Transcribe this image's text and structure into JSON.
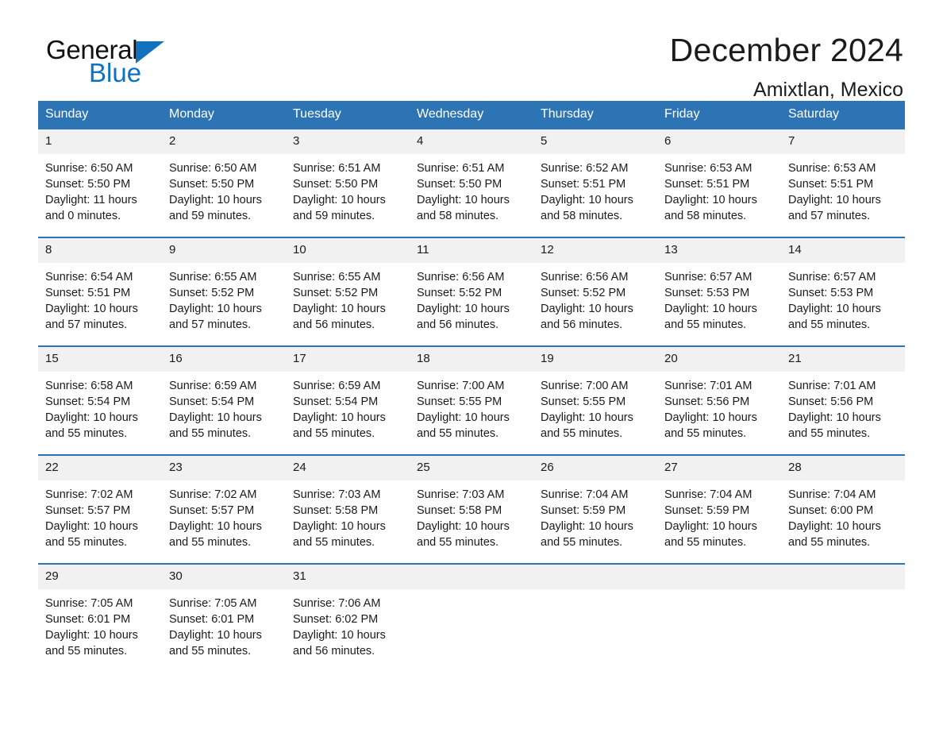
{
  "brand": {
    "name_part1": "General",
    "name_part2": "Blue",
    "mark_icon": "triangle-logo-icon",
    "accent_color": "#0d72c4"
  },
  "header": {
    "title": "December 2024",
    "subtitle": "Amixtlan, Mexico"
  },
  "calendar": {
    "header_color": "#2d74b5",
    "daynum_band_color": "#f1f1f1",
    "weekdays": [
      "Sunday",
      "Monday",
      "Tuesday",
      "Wednesday",
      "Thursday",
      "Friday",
      "Saturday"
    ],
    "weeks": [
      [
        {
          "day": "1",
          "sunrise": "Sunrise: 6:50 AM",
          "sunset": "Sunset: 5:50 PM",
          "daylight": "Daylight: 11 hours and 0 minutes."
        },
        {
          "day": "2",
          "sunrise": "Sunrise: 6:50 AM",
          "sunset": "Sunset: 5:50 PM",
          "daylight": "Daylight: 10 hours and 59 minutes."
        },
        {
          "day": "3",
          "sunrise": "Sunrise: 6:51 AM",
          "sunset": "Sunset: 5:50 PM",
          "daylight": "Daylight: 10 hours and 59 minutes."
        },
        {
          "day": "4",
          "sunrise": "Sunrise: 6:51 AM",
          "sunset": "Sunset: 5:50 PM",
          "daylight": "Daylight: 10 hours and 58 minutes."
        },
        {
          "day": "5",
          "sunrise": "Sunrise: 6:52 AM",
          "sunset": "Sunset: 5:51 PM",
          "daylight": "Daylight: 10 hours and 58 minutes."
        },
        {
          "day": "6",
          "sunrise": "Sunrise: 6:53 AM",
          "sunset": "Sunset: 5:51 PM",
          "daylight": "Daylight: 10 hours and 58 minutes."
        },
        {
          "day": "7",
          "sunrise": "Sunrise: 6:53 AM",
          "sunset": "Sunset: 5:51 PM",
          "daylight": "Daylight: 10 hours and 57 minutes."
        }
      ],
      [
        {
          "day": "8",
          "sunrise": "Sunrise: 6:54 AM",
          "sunset": "Sunset: 5:51 PM",
          "daylight": "Daylight: 10 hours and 57 minutes."
        },
        {
          "day": "9",
          "sunrise": "Sunrise: 6:55 AM",
          "sunset": "Sunset: 5:52 PM",
          "daylight": "Daylight: 10 hours and 57 minutes."
        },
        {
          "day": "10",
          "sunrise": "Sunrise: 6:55 AM",
          "sunset": "Sunset: 5:52 PM",
          "daylight": "Daylight: 10 hours and 56 minutes."
        },
        {
          "day": "11",
          "sunrise": "Sunrise: 6:56 AM",
          "sunset": "Sunset: 5:52 PM",
          "daylight": "Daylight: 10 hours and 56 minutes."
        },
        {
          "day": "12",
          "sunrise": "Sunrise: 6:56 AM",
          "sunset": "Sunset: 5:52 PM",
          "daylight": "Daylight: 10 hours and 56 minutes."
        },
        {
          "day": "13",
          "sunrise": "Sunrise: 6:57 AM",
          "sunset": "Sunset: 5:53 PM",
          "daylight": "Daylight: 10 hours and 55 minutes."
        },
        {
          "day": "14",
          "sunrise": "Sunrise: 6:57 AM",
          "sunset": "Sunset: 5:53 PM",
          "daylight": "Daylight: 10 hours and 55 minutes."
        }
      ],
      [
        {
          "day": "15",
          "sunrise": "Sunrise: 6:58 AM",
          "sunset": "Sunset: 5:54 PM",
          "daylight": "Daylight: 10 hours and 55 minutes."
        },
        {
          "day": "16",
          "sunrise": "Sunrise: 6:59 AM",
          "sunset": "Sunset: 5:54 PM",
          "daylight": "Daylight: 10 hours and 55 minutes."
        },
        {
          "day": "17",
          "sunrise": "Sunrise: 6:59 AM",
          "sunset": "Sunset: 5:54 PM",
          "daylight": "Daylight: 10 hours and 55 minutes."
        },
        {
          "day": "18",
          "sunrise": "Sunrise: 7:00 AM",
          "sunset": "Sunset: 5:55 PM",
          "daylight": "Daylight: 10 hours and 55 minutes."
        },
        {
          "day": "19",
          "sunrise": "Sunrise: 7:00 AM",
          "sunset": "Sunset: 5:55 PM",
          "daylight": "Daylight: 10 hours and 55 minutes."
        },
        {
          "day": "20",
          "sunrise": "Sunrise: 7:01 AM",
          "sunset": "Sunset: 5:56 PM",
          "daylight": "Daylight: 10 hours and 55 minutes."
        },
        {
          "day": "21",
          "sunrise": "Sunrise: 7:01 AM",
          "sunset": "Sunset: 5:56 PM",
          "daylight": "Daylight: 10 hours and 55 minutes."
        }
      ],
      [
        {
          "day": "22",
          "sunrise": "Sunrise: 7:02 AM",
          "sunset": "Sunset: 5:57 PM",
          "daylight": "Daylight: 10 hours and 55 minutes."
        },
        {
          "day": "23",
          "sunrise": "Sunrise: 7:02 AM",
          "sunset": "Sunset: 5:57 PM",
          "daylight": "Daylight: 10 hours and 55 minutes."
        },
        {
          "day": "24",
          "sunrise": "Sunrise: 7:03 AM",
          "sunset": "Sunset: 5:58 PM",
          "daylight": "Daylight: 10 hours and 55 minutes."
        },
        {
          "day": "25",
          "sunrise": "Sunrise: 7:03 AM",
          "sunset": "Sunset: 5:58 PM",
          "daylight": "Daylight: 10 hours and 55 minutes."
        },
        {
          "day": "26",
          "sunrise": "Sunrise: 7:04 AM",
          "sunset": "Sunset: 5:59 PM",
          "daylight": "Daylight: 10 hours and 55 minutes."
        },
        {
          "day": "27",
          "sunrise": "Sunrise: 7:04 AM",
          "sunset": "Sunset: 5:59 PM",
          "daylight": "Daylight: 10 hours and 55 minutes."
        },
        {
          "day": "28",
          "sunrise": "Sunrise: 7:04 AM",
          "sunset": "Sunset: 6:00 PM",
          "daylight": "Daylight: 10 hours and 55 minutes."
        }
      ],
      [
        {
          "day": "29",
          "sunrise": "Sunrise: 7:05 AM",
          "sunset": "Sunset: 6:01 PM",
          "daylight": "Daylight: 10 hours and 55 minutes."
        },
        {
          "day": "30",
          "sunrise": "Sunrise: 7:05 AM",
          "sunset": "Sunset: 6:01 PM",
          "daylight": "Daylight: 10 hours and 55 minutes."
        },
        {
          "day": "31",
          "sunrise": "Sunrise: 7:06 AM",
          "sunset": "Sunset: 6:02 PM",
          "daylight": "Daylight: 10 hours and 56 minutes."
        },
        {
          "day": "",
          "sunrise": "",
          "sunset": "",
          "daylight": ""
        },
        {
          "day": "",
          "sunrise": "",
          "sunset": "",
          "daylight": ""
        },
        {
          "day": "",
          "sunrise": "",
          "sunset": "",
          "daylight": ""
        },
        {
          "day": "",
          "sunrise": "",
          "sunset": "",
          "daylight": ""
        }
      ]
    ]
  }
}
